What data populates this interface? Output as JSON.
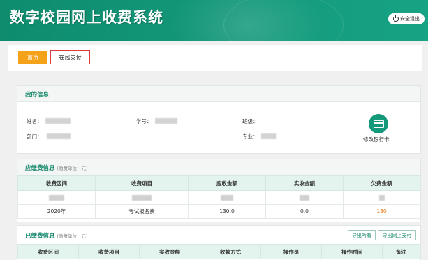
{
  "header": {
    "title": "数字校园网上收费系统",
    "logout_label": "安全退出"
  },
  "tabs": {
    "home": "首页",
    "online_pay": "在线支付"
  },
  "my_info": {
    "title": "我的信息",
    "name_label": "姓名：",
    "student_id_label": "学号：",
    "class_label": "班级：",
    "dept_label": "部门：",
    "major_label": "专业：",
    "bank_card_label": "修改银行卡"
  },
  "due_fees": {
    "title": "应缴费信息",
    "unit": "(缴费单位：元)",
    "columns": [
      "收费区间",
      "收费项目",
      "应收金额",
      "实收金额",
      "欠费金额"
    ],
    "rows": [
      {
        "period": "2020年",
        "item": "考试报名费",
        "due": "130.0",
        "paid": "0.0",
        "owed": "130"
      }
    ]
  },
  "paid_fees": {
    "title": "已缴费信息",
    "unit": "(缴费单位：元)",
    "export_all": "导出所有",
    "export_online": "导出网上支付",
    "columns": [
      "收费区间",
      "收费项目",
      "实收金额",
      "收款方式",
      "操作员",
      "操作时间",
      "备注"
    ]
  }
}
